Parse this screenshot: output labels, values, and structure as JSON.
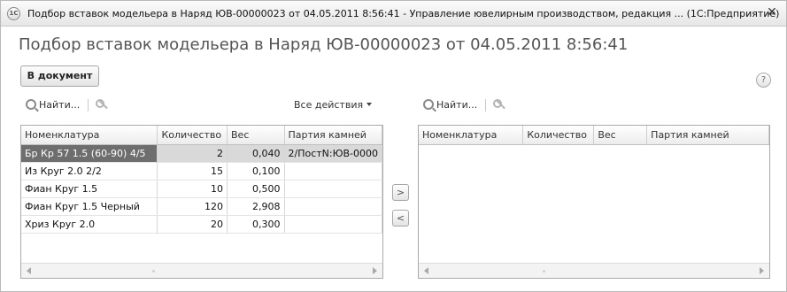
{
  "window": {
    "app_icon": "1С",
    "title": "Подбор вставок модельера в Наряд ЮВ-00000023 от 04.05.2011 8:56:41 - Управление ювелирным производством, редакция ... (1С:Предприятие)",
    "close_glyph": "✕"
  },
  "form": {
    "title": "Подбор вставок модельера в Наряд ЮВ-00000023 от 04.05.2011 8:56:41",
    "to_document_label": "В документ",
    "help_glyph": "?"
  },
  "left_panel": {
    "find_label": "Найти...",
    "all_actions_label": "Все действия",
    "columns": [
      "Номенклатура",
      "Количество",
      "Вес",
      "Партия камней"
    ],
    "rows": [
      {
        "name": "Бр Кр 57 1.5 (60-90) 4/5",
        "qty": "2",
        "weight": "0,040",
        "batch": "2/ПостN:ЮВ-0000",
        "selected": true
      },
      {
        "name": "Из Круг 2.0 2/2",
        "qty": "15",
        "weight": "0,100",
        "batch": "",
        "selected": false
      },
      {
        "name": "Фиан Круг 1.5",
        "qty": "10",
        "weight": "0,500",
        "batch": "",
        "selected": false
      },
      {
        "name": "Фиан Круг 1.5 Черный",
        "qty": "120",
        "weight": "2,908",
        "batch": "",
        "selected": false
      },
      {
        "name": "Хриз Круг 2.0",
        "qty": "20",
        "weight": "0,300",
        "batch": "",
        "selected": false
      }
    ]
  },
  "move_buttons": {
    "right_glyph": ">",
    "left_glyph": "<"
  },
  "right_panel": {
    "find_label": "Найти...",
    "columns": [
      "Номенклатура",
      "Количество",
      "Вес",
      "Партия камней"
    ],
    "rows": []
  },
  "icons": {
    "app": "app-logo-icon",
    "find": "search-icon",
    "cancel_search": "cancel-search-icon",
    "dropdown": "caret-down-icon",
    "help": "help-icon",
    "close": "close-icon"
  }
}
